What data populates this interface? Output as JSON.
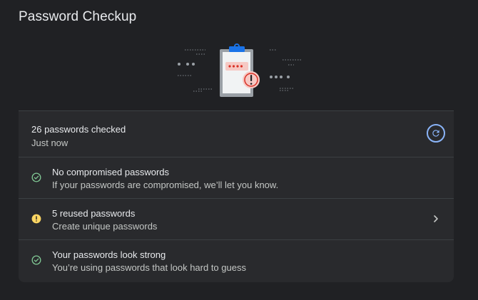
{
  "page": {
    "title": "Password Checkup"
  },
  "summary": {
    "checked_label": "26 passwords checked",
    "time_label": "Just now",
    "refresh_icon": "refresh-icon"
  },
  "checks": [
    {
      "title": "No compromised passwords",
      "subtitle": "If your passwords are compromised, we’ll let you know.",
      "icon": "check-circle-icon",
      "status_color": "#81c995"
    },
    {
      "title": "5 reused passwords",
      "subtitle": "Create unique passwords",
      "icon": "warning-circle-icon",
      "status_color": "#fdd663",
      "has_chevron": true
    },
    {
      "title": "Your passwords look strong",
      "subtitle": "You’re using passwords that look hard to guess",
      "icon": "check-circle-icon",
      "status_color": "#81c995"
    }
  ],
  "colors": {
    "accent": "#8ab4f8",
    "clipboard_blue": "#1a73e8",
    "alert_red": "#d93025",
    "background": "#202124",
    "card": "#292a2d"
  }
}
